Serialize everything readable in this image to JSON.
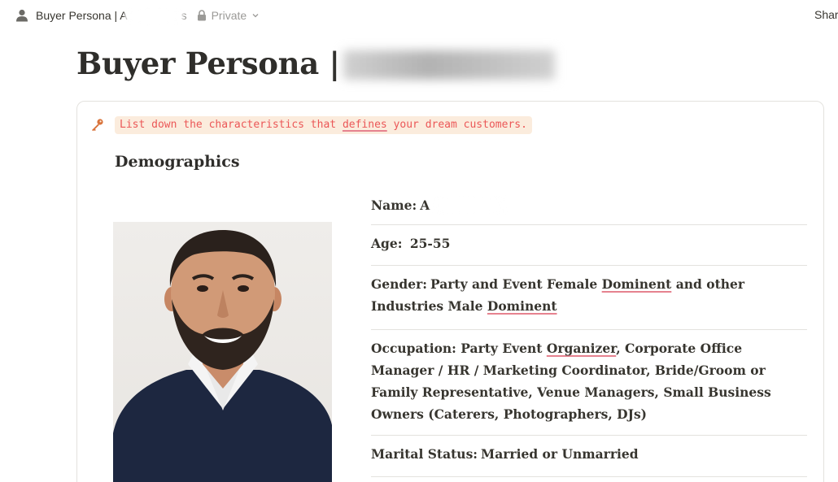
{
  "topbar": {
    "breadcrumb_title": "Buyer Persona | A",
    "breadcrumb_tail": "s",
    "privacy": "Private",
    "share_label": "Share"
  },
  "page": {
    "title": "Buyer Persona |"
  },
  "callout": {
    "icon": "key-icon",
    "text_before": "List down the characteristics that ",
    "text_flagged": "defines",
    "text_after": " your dream customers."
  },
  "section": {
    "heading": "Demographics"
  },
  "attributes": {
    "name_label": "Name:",
    "name_value": "A",
    "age_label": "Age:",
    "age_value": "25-55",
    "gender_label": "Gender:",
    "gender_text_1": "Party and Event Female ",
    "gender_flag_1": "Dominent",
    "gender_text_2": " and other Industries Male ",
    "gender_flag_2": "Dominent",
    "occupation_label": "Occupation:",
    "occupation_text_1": " Party Event ",
    "occupation_flag": "Organizer",
    "occupation_text_2": ", Corporate Office Manager / HR / Marketing Coordinator, Bride/Groom or Family Representative, Venue Managers, Small Business Owners (Caterers, Photographers, DJs)",
    "marital_label": "Marital Status:",
    "marital_value": "Married or Unmarried"
  },
  "colors": {
    "callout_bg": "#fbecdd",
    "callout_text": "#eb5757",
    "spellcheck_underline": "#e6828f",
    "divider": "#e3e2de"
  }
}
